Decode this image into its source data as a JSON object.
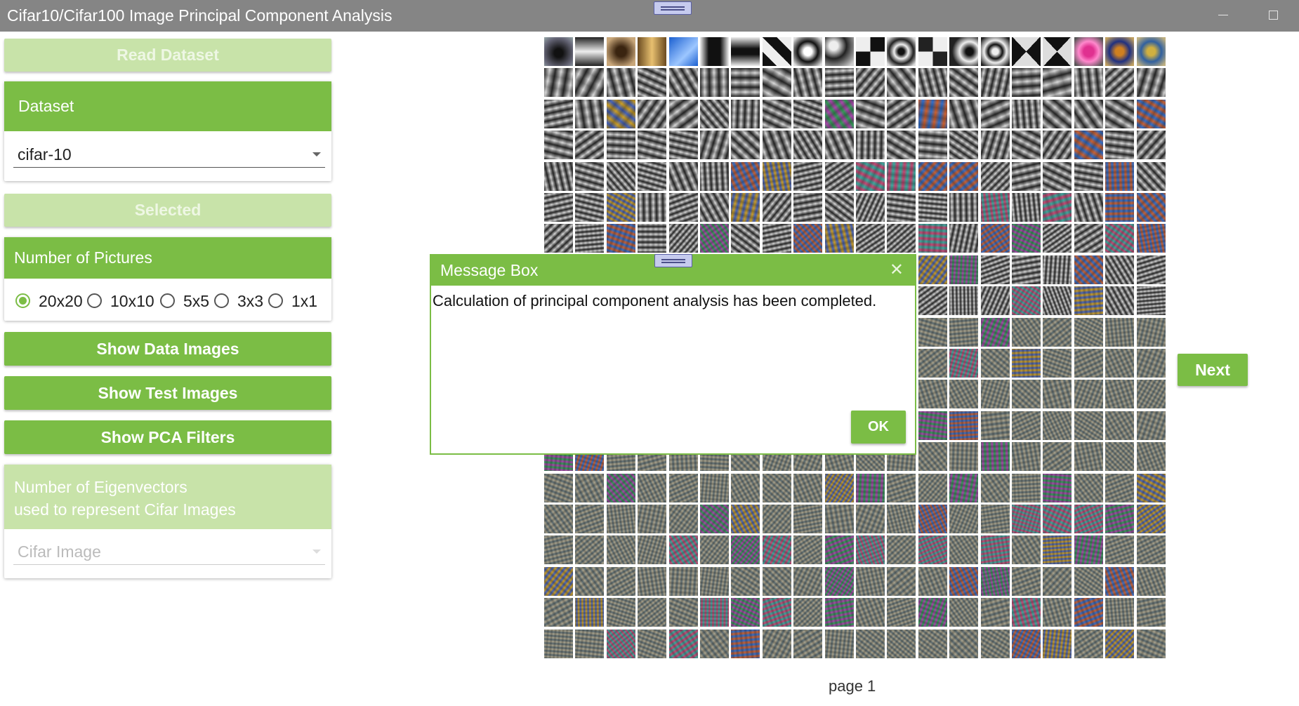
{
  "window": {
    "title": "Cifar10/Cifar100 Image Principal Component Analysis"
  },
  "sidebar": {
    "read_dataset_label": "Read Dataset",
    "dataset_header": "Dataset",
    "dataset_value": "cifar-10",
    "selected_label": "Selected",
    "pictures_header": "Number of Pictures",
    "picture_options": [
      "20x20",
      "10x10",
      "5x5",
      "3x3",
      "1x1"
    ],
    "picture_selected": "20x20",
    "show_data_label": "Show Data Images",
    "show_test_label": "Show Test Images",
    "show_pca_label": "Show PCA Filters",
    "eigen_header_line1": "Number of Eigenvectors",
    "eigen_header_line2": "used to represent Cifar Images",
    "cifar_image_placeholder": "Cifar Image"
  },
  "viewer": {
    "grid_rows": 20,
    "grid_cols": 20,
    "next_label": "Next",
    "page_label": "page 1"
  },
  "dialog": {
    "title": "Message Box",
    "message": "Calculation of principal component analysis has been completed.",
    "ok_label": "OK",
    "close_symbol": "✕"
  },
  "colors": {
    "accent": "#7bbd45",
    "accent_light": "#c8e3a9",
    "titlebar": "#858585"
  }
}
